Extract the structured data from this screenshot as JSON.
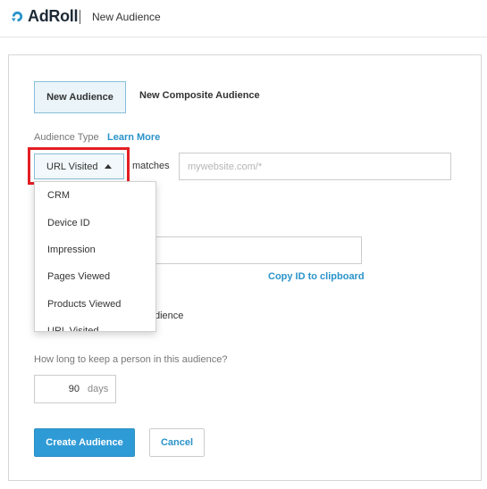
{
  "header": {
    "logo_text": "AdRoll",
    "page_title": "New Audience",
    "brand_color": "#2a93c9"
  },
  "tabs": [
    {
      "label": "New Audience",
      "active": true
    },
    {
      "label": "New Composite Audience",
      "active": false
    }
  ],
  "audience_type": {
    "label": "Audience Type",
    "learn_more": "Learn More",
    "selected": "URL Visited",
    "matches_label": "matches",
    "url_placeholder": "mywebsite.com/*",
    "options": [
      "CRM",
      "Device ID",
      "Impression",
      "Pages Viewed",
      "Products Viewed",
      "URL Visited"
    ]
  },
  "copy_id_label": "Copy ID to clipboard",
  "partial_label": "dience",
  "duration": {
    "label": "How long to keep a person in this audience?",
    "value": "90",
    "unit": "days"
  },
  "buttons": {
    "create": "Create Audience",
    "cancel": "Cancel"
  },
  "colors": {
    "primary_button": "#2f9bd6",
    "highlight": "#e31e24",
    "link": "#2a93c9"
  }
}
